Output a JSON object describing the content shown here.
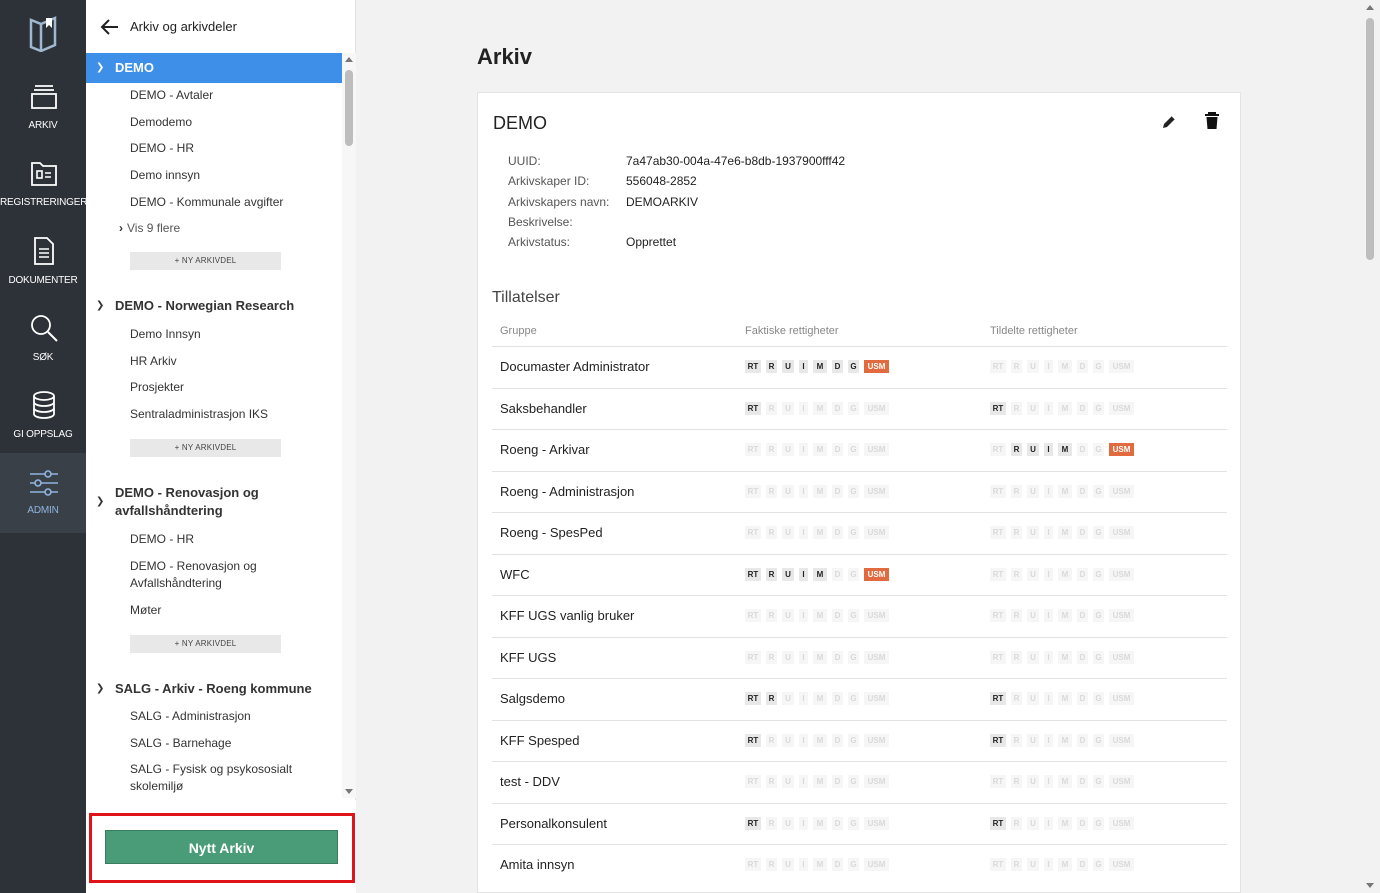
{
  "nav": {
    "items": [
      {
        "label": "ARKIV",
        "icon": "archive-icon"
      },
      {
        "label": "REGISTRERINGER",
        "icon": "folder-icon"
      },
      {
        "label": "DOKUMENTER",
        "icon": "document-icon"
      },
      {
        "label": "SØK",
        "icon": "search-icon"
      },
      {
        "label": "GI OPPSLAG",
        "icon": "database-icon"
      },
      {
        "label": "ADMIN",
        "icon": "sliders-icon"
      }
    ],
    "active": "ADMIN"
  },
  "tree": {
    "title": "Arkiv og arkivdeler",
    "new_part_label": "NY ARKIVDEL",
    "groups": [
      {
        "name": "DEMO",
        "selected": true,
        "children": [
          "DEMO - Avtaler",
          "Demodemo",
          "DEMO - HR",
          "Demo innsyn",
          "DEMO - Kommunale avgifter"
        ],
        "more": "Vis 9 flere"
      },
      {
        "name": "DEMO - Norwegian Research",
        "children": [
          "Demo Innsyn",
          "HR Arkiv",
          "Prosjekter",
          "Sentraladministrasjon IKS"
        ]
      },
      {
        "name": "DEMO - Renovasjon og avfallshåndtering",
        "children": [
          "DEMO - HR",
          "DEMO - Renovasjon og Avfallshåndtering",
          "Møter"
        ]
      },
      {
        "name": "SALG - Arkiv - Roeng kommune",
        "children": [
          "SALG - Administrasjon",
          "SALG - Barnehage",
          "SALG - Fysisk og psykososialt skolemiljø"
        ]
      }
    ]
  },
  "new_archive_button": "Nytt Arkiv",
  "main": {
    "page_title": "Arkiv",
    "card": {
      "title": "DEMO",
      "meta": [
        {
          "key": "UUID:",
          "value": "7a47ab30-004a-47e6-b8db-1937900fff42"
        },
        {
          "key": "Arkivskaper ID:",
          "value": "556048-2852"
        },
        {
          "key": "Arkivskapers navn:",
          "value": "DEMOARKIV"
        },
        {
          "key": "Beskrivelse:",
          "value": ""
        },
        {
          "key": "Arkivstatus:",
          "value": "Opprettet"
        }
      ],
      "permissions_title": "Tillatelser",
      "columns": [
        "Gruppe",
        "Faktiske rettigheter",
        "Tildelte rettigheter"
      ],
      "perm_codes": [
        "RT",
        "R",
        "U",
        "I",
        "M",
        "D",
        "G",
        "USM"
      ],
      "rows": [
        {
          "group": "Documaster Administrator",
          "actual": [
            1,
            1,
            1,
            1,
            1,
            1,
            1,
            1
          ],
          "assigned": [
            0,
            0,
            0,
            0,
            0,
            0,
            0,
            0
          ]
        },
        {
          "group": "Saksbehandler",
          "actual": [
            1,
            0,
            0,
            0,
            0,
            0,
            0,
            0
          ],
          "assigned": [
            1,
            0,
            0,
            0,
            0,
            0,
            0,
            0
          ]
        },
        {
          "group": "Roeng - Arkivar",
          "actual": [
            0,
            0,
            0,
            0,
            0,
            0,
            0,
            0
          ],
          "assigned": [
            0,
            1,
            1,
            1,
            1,
            0,
            0,
            1
          ]
        },
        {
          "group": "Roeng - Administrasjon",
          "actual": [
            0,
            0,
            0,
            0,
            0,
            0,
            0,
            0
          ],
          "assigned": [
            0,
            0,
            0,
            0,
            0,
            0,
            0,
            0
          ]
        },
        {
          "group": "Roeng - SpesPed",
          "actual": [
            0,
            0,
            0,
            0,
            0,
            0,
            0,
            0
          ],
          "assigned": [
            0,
            0,
            0,
            0,
            0,
            0,
            0,
            0
          ]
        },
        {
          "group": "WFC",
          "actual": [
            1,
            1,
            1,
            1,
            1,
            0,
            0,
            1
          ],
          "assigned": [
            0,
            0,
            0,
            0,
            0,
            0,
            0,
            0
          ]
        },
        {
          "group": "KFF UGS vanlig bruker",
          "actual": [
            0,
            0,
            0,
            0,
            0,
            0,
            0,
            0
          ],
          "assigned": [
            0,
            0,
            0,
            0,
            0,
            0,
            0,
            0
          ]
        },
        {
          "group": "KFF UGS",
          "actual": [
            0,
            0,
            0,
            0,
            0,
            0,
            0,
            0
          ],
          "assigned": [
            0,
            0,
            0,
            0,
            0,
            0,
            0,
            0
          ]
        },
        {
          "group": "Salgsdemo",
          "actual": [
            1,
            1,
            0,
            0,
            0,
            0,
            0,
            0
          ],
          "assigned": [
            1,
            0,
            0,
            0,
            0,
            0,
            0,
            0
          ]
        },
        {
          "group": "KFF Spesped",
          "actual": [
            1,
            0,
            0,
            0,
            0,
            0,
            0,
            0
          ],
          "assigned": [
            1,
            0,
            0,
            0,
            0,
            0,
            0,
            0
          ]
        },
        {
          "group": "test - DDV",
          "actual": [
            0,
            0,
            0,
            0,
            0,
            0,
            0,
            0
          ],
          "assigned": [
            0,
            0,
            0,
            0,
            0,
            0,
            0,
            0
          ]
        },
        {
          "group": "Personalkonsulent",
          "actual": [
            1,
            0,
            0,
            0,
            0,
            0,
            0,
            0
          ],
          "assigned": [
            1,
            0,
            0,
            0,
            0,
            0,
            0,
            0
          ]
        },
        {
          "group": "Amita innsyn",
          "actual": [
            0,
            0,
            0,
            0,
            0,
            0,
            0,
            0
          ],
          "assigned": [
            0,
            0,
            0,
            0,
            0,
            0,
            0,
            0
          ]
        }
      ]
    }
  },
  "colors": {
    "nav_bg": "#2d3238",
    "selected": "#3d8fe8",
    "button": "#4a9b78",
    "usm": "#e16b3f",
    "highlight": "#e0131a"
  }
}
